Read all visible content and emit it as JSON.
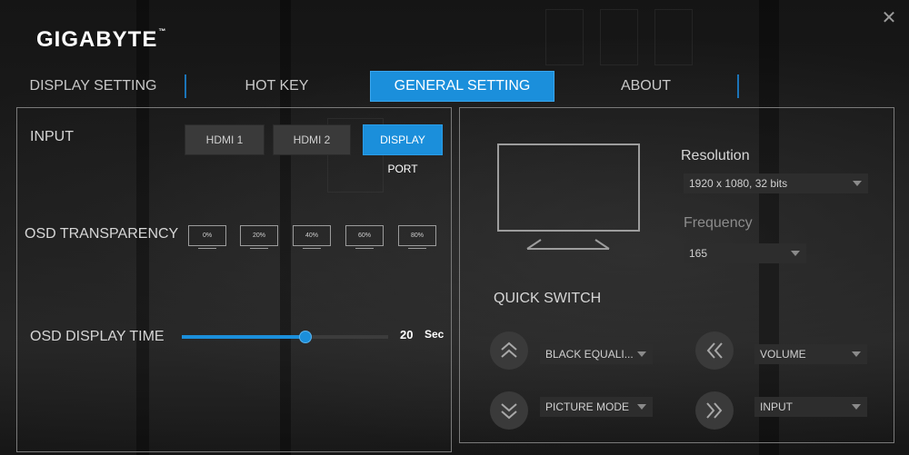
{
  "app": {
    "brand": "GIGABYTE",
    "trademark": "™"
  },
  "window": {
    "close_glyph": "✕"
  },
  "tabs": [
    {
      "label": "DISPLAY SETTING"
    },
    {
      "label": "HOT KEY"
    },
    {
      "label": "GENERAL SETTING",
      "active": true
    },
    {
      "label": "ABOUT"
    }
  ],
  "general": {
    "input": {
      "label": "INPUT",
      "options": [
        "HDMI 1",
        "HDMI 2",
        "DISPLAY PORT"
      ],
      "selected": "DISPLAY PORT"
    },
    "osd_transparency": {
      "label": "OSD TRANSPARENCY",
      "options": [
        "0%",
        "20%",
        "40%",
        "60%",
        "80%"
      ]
    },
    "osd_display_time": {
      "label": "OSD DISPLAY TIME",
      "value": "20",
      "unit": "Sec",
      "level_fraction": 0.6
    }
  },
  "display": {
    "resolution": {
      "label": "Resolution",
      "value": "1920 x 1080, 32 bits"
    },
    "frequency": {
      "label": "Frequency",
      "value": "165"
    }
  },
  "quick_switch": {
    "label": "QUICK SWITCH",
    "up": "BLACK EQUALI...",
    "down": "PICTURE MODE",
    "left": "VOLUME",
    "right": "INPUT"
  },
  "colors": {
    "accent": "#1b8fdb",
    "panel_border": "#7a7a7a",
    "background": "#191919"
  }
}
